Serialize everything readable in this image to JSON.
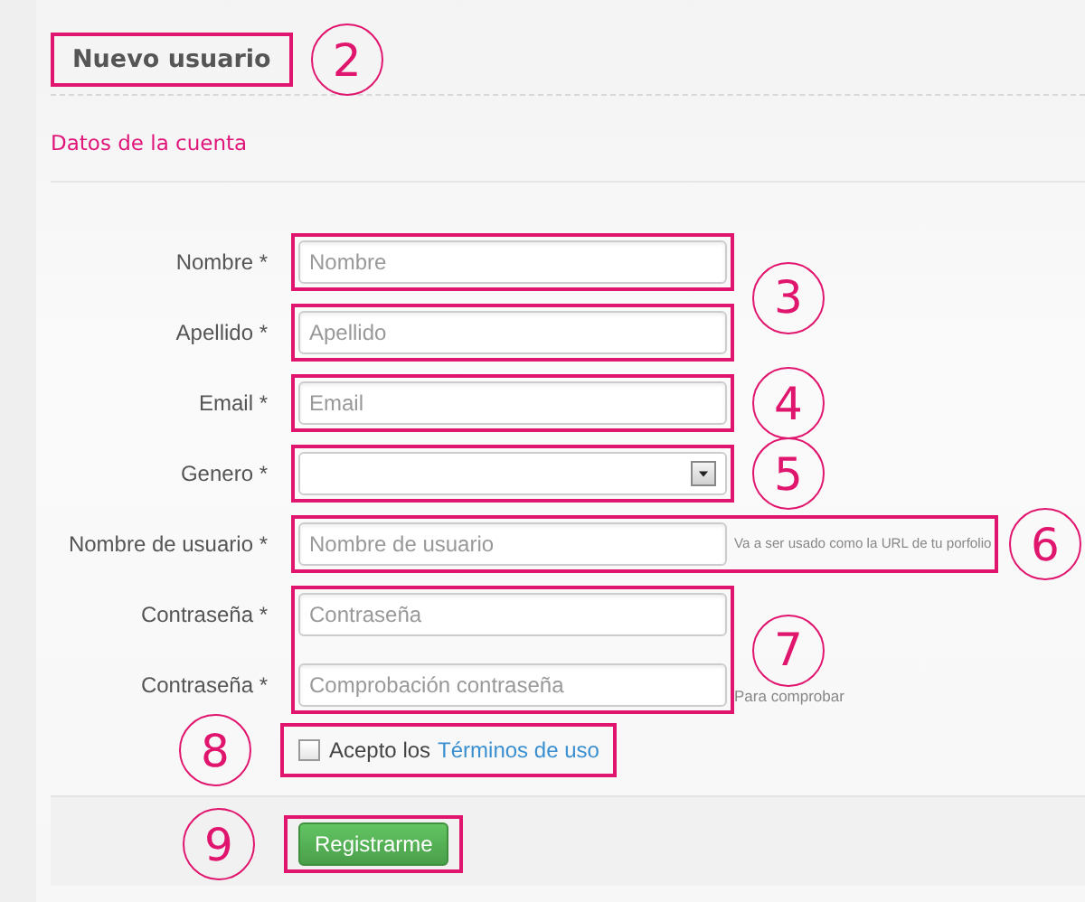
{
  "header": {
    "title": "Nuevo usuario",
    "callout": {
      "number": "2"
    }
  },
  "section_title": "Datos de la cuenta",
  "groups": [
    {
      "callout": {
        "number": "3"
      },
      "boxes": [
        [
          {
            "kind": "text",
            "label": "Nombre *",
            "placeholder": "Nombre"
          }
        ],
        [
          {
            "kind": "text",
            "label": "Apellido *",
            "placeholder": "Apellido"
          }
        ]
      ]
    },
    {
      "callout": {
        "number": "4"
      },
      "boxes": [
        [
          {
            "kind": "text",
            "label": "Email *",
            "placeholder": "Email"
          }
        ]
      ]
    },
    {
      "callout": {
        "number": "5"
      },
      "boxes": [
        [
          {
            "kind": "select",
            "label": "Genero *"
          }
        ]
      ]
    },
    {
      "callout": {
        "number": "6"
      },
      "boxes": [
        [
          {
            "kind": "text",
            "label": "Nombre de usuario *",
            "placeholder": "Nombre de usuario",
            "help": "Va a ser usado como la URL de tu porfolio"
          }
        ]
      ]
    },
    {
      "callout": {
        "number": "7"
      },
      "boxes": [
        [
          {
            "kind": "password",
            "label": "Contraseña *",
            "placeholder": "Contraseña"
          },
          {
            "kind": "password",
            "label": "Contraseña *",
            "placeholder": "Comprobación contraseña",
            "note": "Para comprobar"
          }
        ]
      ]
    }
  ],
  "terms": {
    "checked": false,
    "text": "Acepto los",
    "link": "Términos de uso",
    "callout": {
      "number": "8"
    }
  },
  "submit": {
    "label": "Registrarme",
    "callout": {
      "number": "9"
    }
  }
}
